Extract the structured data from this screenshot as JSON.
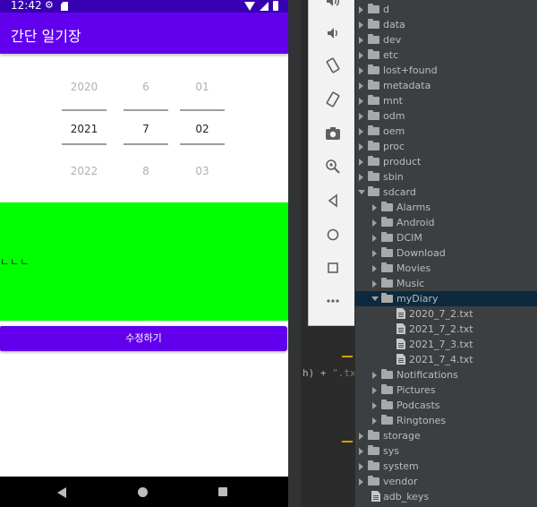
{
  "phone": {
    "status_bar": {
      "time": "12:42"
    },
    "app_bar": {
      "title": "간단 일기장"
    },
    "date_picker": {
      "year": {
        "prev": "2020",
        "current": "2021",
        "next": "2022"
      },
      "month": {
        "prev": "6",
        "current": "7",
        "next": "8"
      },
      "day": {
        "prev": "01",
        "current": "02",
        "next": "03"
      }
    },
    "diary_content": {
      "text": "ㄴㄴㄴ",
      "background": "#00ff00"
    },
    "edit_button": {
      "label": "수정하기"
    },
    "accent_color": "#6200ee",
    "status_color": "#3700b3"
  },
  "emulator_toolbar": {
    "buttons": [
      "volume-up-icon",
      "volume-down-icon",
      "rotate-left-icon",
      "rotate-right-icon",
      "camera-icon",
      "zoom-icon",
      "back-icon",
      "home-icon",
      "overview-icon",
      "more-icon"
    ]
  },
  "code_snippet": {
    "text1": "h) + ",
    "text2": "\".tx"
  },
  "explorer": {
    "rows": [
      {
        "label": "d",
        "type": "folder",
        "expanded": false
      },
      {
        "label": "data",
        "type": "folder",
        "expanded": false
      },
      {
        "label": "dev",
        "type": "folder",
        "expanded": false
      },
      {
        "label": "etc",
        "type": "folder",
        "expanded": false
      },
      {
        "label": "lost+found",
        "type": "folder",
        "expanded": false
      },
      {
        "label": "metadata",
        "type": "folder",
        "expanded": false
      },
      {
        "label": "mnt",
        "type": "folder",
        "expanded": false
      },
      {
        "label": "odm",
        "type": "folder",
        "expanded": false
      },
      {
        "label": "oem",
        "type": "folder",
        "expanded": false
      },
      {
        "label": "proc",
        "type": "folder",
        "expanded": false
      },
      {
        "label": "product",
        "type": "folder",
        "expanded": false
      },
      {
        "label": "sbin",
        "type": "folder",
        "expanded": false
      },
      {
        "label": "sdcard",
        "type": "folder",
        "expanded": true
      },
      {
        "label": "Alarms",
        "type": "folder",
        "expanded": false
      },
      {
        "label": "Android",
        "type": "folder",
        "expanded": false
      },
      {
        "label": "DCIM",
        "type": "folder",
        "expanded": false
      },
      {
        "label": "Download",
        "type": "folder",
        "expanded": false
      },
      {
        "label": "Movies",
        "type": "folder",
        "expanded": false
      },
      {
        "label": "Music",
        "type": "folder",
        "expanded": false
      },
      {
        "label": "myDiary",
        "type": "folder",
        "expanded": true,
        "selected": true
      },
      {
        "label": "2020_7_2.txt",
        "type": "file"
      },
      {
        "label": "2021_7_2.txt",
        "type": "file"
      },
      {
        "label": "2021_7_3.txt",
        "type": "file"
      },
      {
        "label": "2021_7_4.txt",
        "type": "file"
      },
      {
        "label": "Notifications",
        "type": "folder",
        "expanded": false
      },
      {
        "label": "Pictures",
        "type": "folder",
        "expanded": false
      },
      {
        "label": "Podcasts",
        "type": "folder",
        "expanded": false
      },
      {
        "label": "Ringtones",
        "type": "folder",
        "expanded": false
      },
      {
        "label": "storage",
        "type": "folder",
        "expanded": false
      },
      {
        "label": "sys",
        "type": "folder",
        "expanded": false
      },
      {
        "label": "system",
        "type": "folder",
        "expanded": false
      },
      {
        "label": "vendor",
        "type": "folder",
        "expanded": false
      },
      {
        "label": "adb_keys",
        "type": "file"
      }
    ]
  }
}
